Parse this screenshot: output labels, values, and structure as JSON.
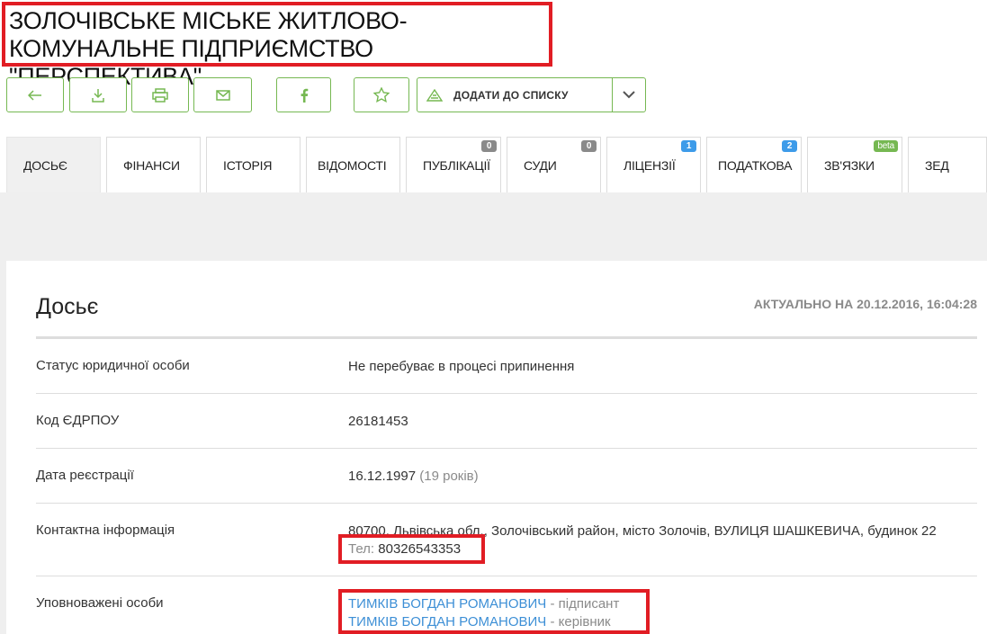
{
  "page": {
    "company_name": "ЗОЛОЧІВСЬКЕ МІСЬКЕ ЖИТЛОВО-КОМУНАЛЬНЕ ПІДПРИЄМСТВО \"ПЕРСПЕКТИВА\""
  },
  "toolbar": {
    "add_to_list_label": "ДОДАТИ ДО СПИСКУ",
    "icons": [
      "back-arrow-icon",
      "download-icon",
      "print-icon",
      "mail-icon",
      "facebook-icon",
      "star-icon",
      "list-icon",
      "chevron-down-icon"
    ]
  },
  "tabs": [
    {
      "label": "ДОСЬЄ",
      "badge": ""
    },
    {
      "label": "ФІНАНСИ",
      "badge": ""
    },
    {
      "label": "ІСТОРІЯ",
      "badge": ""
    },
    {
      "label": "ВІДОМОСТІ",
      "badge": ""
    },
    {
      "label": "ПУБЛІКАЦІЇ",
      "badge": "0"
    },
    {
      "label": "СУДИ",
      "badge": "0"
    },
    {
      "label": "ЛІЦЕНЗІЇ",
      "badge": "1"
    },
    {
      "label": "ПОДАТКОВА",
      "badge": "2"
    },
    {
      "label": "ЗВ'ЯЗКИ",
      "badge": "beta"
    },
    {
      "label": "ЗЕД",
      "badge": ""
    }
  ],
  "dossier": {
    "heading": "Досьє",
    "updated": "АКТУАЛЬНО НА 20.12.2016, 16:04:28",
    "rows": {
      "status": {
        "label": "Статус юридичної особи",
        "value": "Не перебуває в процесі припинення"
      },
      "code": {
        "label": "Код ЄДРПОУ",
        "value": "26181453"
      },
      "registration": {
        "label": "Дата реєстрації",
        "value": "16.12.1997",
        "age": "(19 років)"
      },
      "contacts": {
        "label": "Контактна інформація",
        "address": "80700, Львівська обл., Золочівський район, місто Золочів, ВУЛИЦЯ ШАШКЕВИЧА, будинок 22",
        "phone_label": "Тел:",
        "phone": "80326543353"
      },
      "persons": {
        "label": "Уповноважені особи",
        "list": [
          {
            "name": "ТИМКІВ БОГДАН РОМАНОВИЧ",
            "role": "- підписант"
          },
          {
            "name": "ТИМКІВ БОГДАН РОМАНОВИЧ",
            "role": "- керівник"
          }
        ]
      }
    }
  },
  "colors": {
    "accent": "#76b852",
    "link": "#3d8fd6",
    "highlight": "#e11d24",
    "badge_gray": "#8a8a8a",
    "badge_blue": "#3d9be9"
  }
}
